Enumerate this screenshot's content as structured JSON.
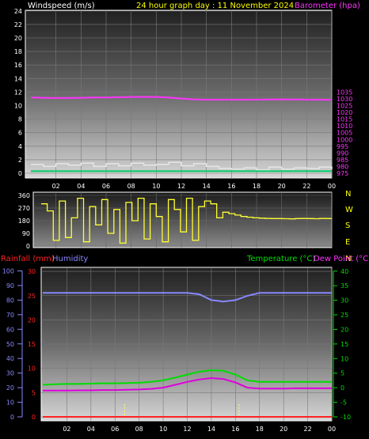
{
  "header": {
    "left": "Windspeed (m/s)",
    "center": "24 hour graph day : 11 November 2024",
    "right": "Barometer (hpa)"
  },
  "footer_labels": {
    "rainfall": "Rainfall (mm)",
    "humidity": "Humidity",
    "temperature": "Temperature (°C)",
    "dewpoint": "Dew Point (°C)"
  },
  "compass": [
    "N",
    "W",
    "S",
    "E",
    "N"
  ],
  "colors": {
    "windspeed": "#e6e6e6",
    "gust": "#e6e6e6",
    "windspeed_avg": "#00cc66",
    "barometer": "#ff33ff",
    "direction": "#ffff33",
    "rainfall": "#ff2222",
    "humidity": "#8888ff",
    "temperature": "#00dd00",
    "dewpoint": "#dd00dd",
    "header_text": "#ffff00",
    "axis_text": "#ffffff"
  },
  "chart_data": [
    {
      "type": "line",
      "x_ticks": [
        "02",
        "04",
        "06",
        "08",
        "10",
        "12",
        "14",
        "16",
        "18",
        "20",
        "22",
        "00"
      ],
      "y_left_ticks": [
        0,
        2,
        4,
        6,
        8,
        10,
        12,
        14,
        16,
        18,
        20,
        22,
        24
      ],
      "y_right_ticks": [
        975,
        980,
        985,
        990,
        995,
        1000,
        1005,
        1010,
        1015,
        1020,
        1025,
        1030,
        1035
      ],
      "ylim_left": [
        0,
        25
      ],
      "ylim_right": [
        972.5,
        1037.5
      ],
      "x_hours": [
        0,
        1,
        2,
        3,
        4,
        5,
        6,
        7,
        8,
        9,
        10,
        11,
        12,
        13,
        14,
        15,
        16,
        17,
        18,
        19,
        20,
        21,
        22,
        23,
        24
      ],
      "series": [
        {
          "key": "barometer",
          "axis": "right",
          "values": [
            1031,
            1030.8,
            1030.6,
            1030.6,
            1030.8,
            1031,
            1031,
            1031.2,
            1031.4,
            1031.5,
            1031.4,
            1031,
            1030.2,
            1029.6,
            1029.4,
            1029.4,
            1029.4,
            1029.4,
            1029.4,
            1029.5,
            1029.6,
            1029.5,
            1029.4,
            1029.3,
            1029.3
          ]
        },
        {
          "key": "windspeed",
          "axis": "left",
          "values": [
            1.3,
            1.0,
            1.4,
            1.2,
            1.5,
            1.0,
            1.4,
            1.1,
            1.5,
            1.2,
            1.3,
            1.6,
            1.1,
            1.4,
            1.0,
            0.7,
            0.6,
            0.8,
            0.5,
            0.9,
            0.6,
            0.8,
            0.7,
            0.9,
            0.6
          ]
        },
        {
          "key": "windspeed_avg",
          "axis": "left",
          "values": [
            0.3,
            0.3,
            0.3,
            0.3,
            0.3,
            0.3,
            0.3,
            0.3,
            0.3,
            0.3,
            0.3,
            0.3,
            0.3,
            0.3,
            0.3,
            0.3,
            0.3,
            0.3,
            0.3,
            0.3,
            0.3,
            0.3,
            0.3,
            0.3,
            0.3
          ]
        }
      ]
    },
    {
      "type": "line",
      "y_left_ticks": [
        0,
        90,
        180,
        270,
        360
      ],
      "ylim": [
        0,
        360
      ],
      "x_hours": [
        0,
        0.5,
        1,
        1.5,
        2,
        2.5,
        3,
        3.5,
        4,
        4.5,
        5,
        5.5,
        6,
        6.5,
        7,
        7.5,
        8,
        8.5,
        9,
        9.5,
        10,
        10.5,
        11,
        11.5,
        12,
        12.5,
        13,
        13.5,
        14,
        14.5,
        15,
        15.5,
        16,
        16.5,
        17,
        17.5,
        18,
        18.5,
        19,
        19.5,
        20,
        20.5,
        21,
        21.5,
        22,
        22.5,
        23,
        23.5,
        24
      ],
      "series": [
        {
          "key": "direction",
          "values": [
            300,
            250,
            40,
            320,
            60,
            200,
            340,
            30,
            280,
            150,
            330,
            90,
            260,
            20,
            310,
            180,
            340,
            50,
            300,
            210,
            30,
            330,
            260,
            100,
            340,
            40,
            280,
            320,
            300,
            200,
            240,
            230,
            220,
            210,
            205,
            200,
            198,
            196,
            195,
            195,
            194,
            193,
            195,
            196,
            195,
            194,
            196,
            195,
            195
          ]
        }
      ]
    },
    {
      "type": "line",
      "x_ticks": [
        "02",
        "04",
        "06",
        "08",
        "10",
        "12",
        "14",
        "16",
        "18",
        "20",
        "22",
        "00"
      ],
      "y_humidity_ticks": [
        0,
        10,
        20,
        30,
        40,
        50,
        60,
        70,
        80,
        90,
        100
      ],
      "y_rain_ticks": [
        0,
        5,
        10,
        15,
        20,
        25,
        30
      ],
      "y_temp_ticks": [
        -10,
        -5,
        0,
        5,
        10,
        15,
        20,
        25,
        30,
        35,
        40
      ],
      "ylim_humidity": [
        0,
        100
      ],
      "ylim_rain": [
        0,
        30
      ],
      "ylim_temp": [
        -10,
        40
      ],
      "x_hours": [
        0,
        1,
        2,
        3,
        4,
        5,
        6,
        7,
        8,
        9,
        10,
        11,
        12,
        13,
        14,
        15,
        16,
        17,
        18,
        19,
        20,
        21,
        22,
        23,
        24
      ],
      "series": [
        {
          "key": "humidity",
          "axis": "humidity",
          "values": [
            85,
            85,
            85,
            85,
            85,
            85,
            85,
            85,
            85,
            85,
            85,
            85,
            85,
            84,
            80,
            79,
            80,
            83,
            85,
            85,
            85,
            85,
            85,
            85,
            85
          ]
        },
        {
          "key": "temperature",
          "axis": "temp",
          "values": [
            1,
            1.2,
            1.3,
            1.3,
            1.4,
            1.5,
            1.5,
            1.6,
            1.7,
            2,
            2.5,
            3.5,
            4.5,
            5.5,
            6,
            5.8,
            4.5,
            2.5,
            2,
            2,
            2,
            2,
            2,
            2,
            2
          ]
        },
        {
          "key": "dewpoint",
          "axis": "temp",
          "values": [
            -1,
            -1,
            -1,
            -0.9,
            -0.9,
            -0.8,
            -0.8,
            -0.7,
            -0.6,
            -0.4,
            0,
            1,
            2,
            2.8,
            3.3,
            3,
            1.8,
            0,
            -0.3,
            -0.3,
            -0.3,
            -0.2,
            -0.2,
            -0.2,
            -0.2
          ]
        },
        {
          "key": "rainfall",
          "axis": "rain",
          "values": [
            0,
            0,
            0,
            0,
            0,
            0,
            0,
            0,
            0,
            0,
            0,
            0,
            0,
            0,
            0,
            0,
            0,
            0,
            0,
            0,
            0,
            0,
            0,
            0,
            0
          ]
        }
      ],
      "rain_markers": [
        6.8,
        16.3
      ]
    }
  ]
}
